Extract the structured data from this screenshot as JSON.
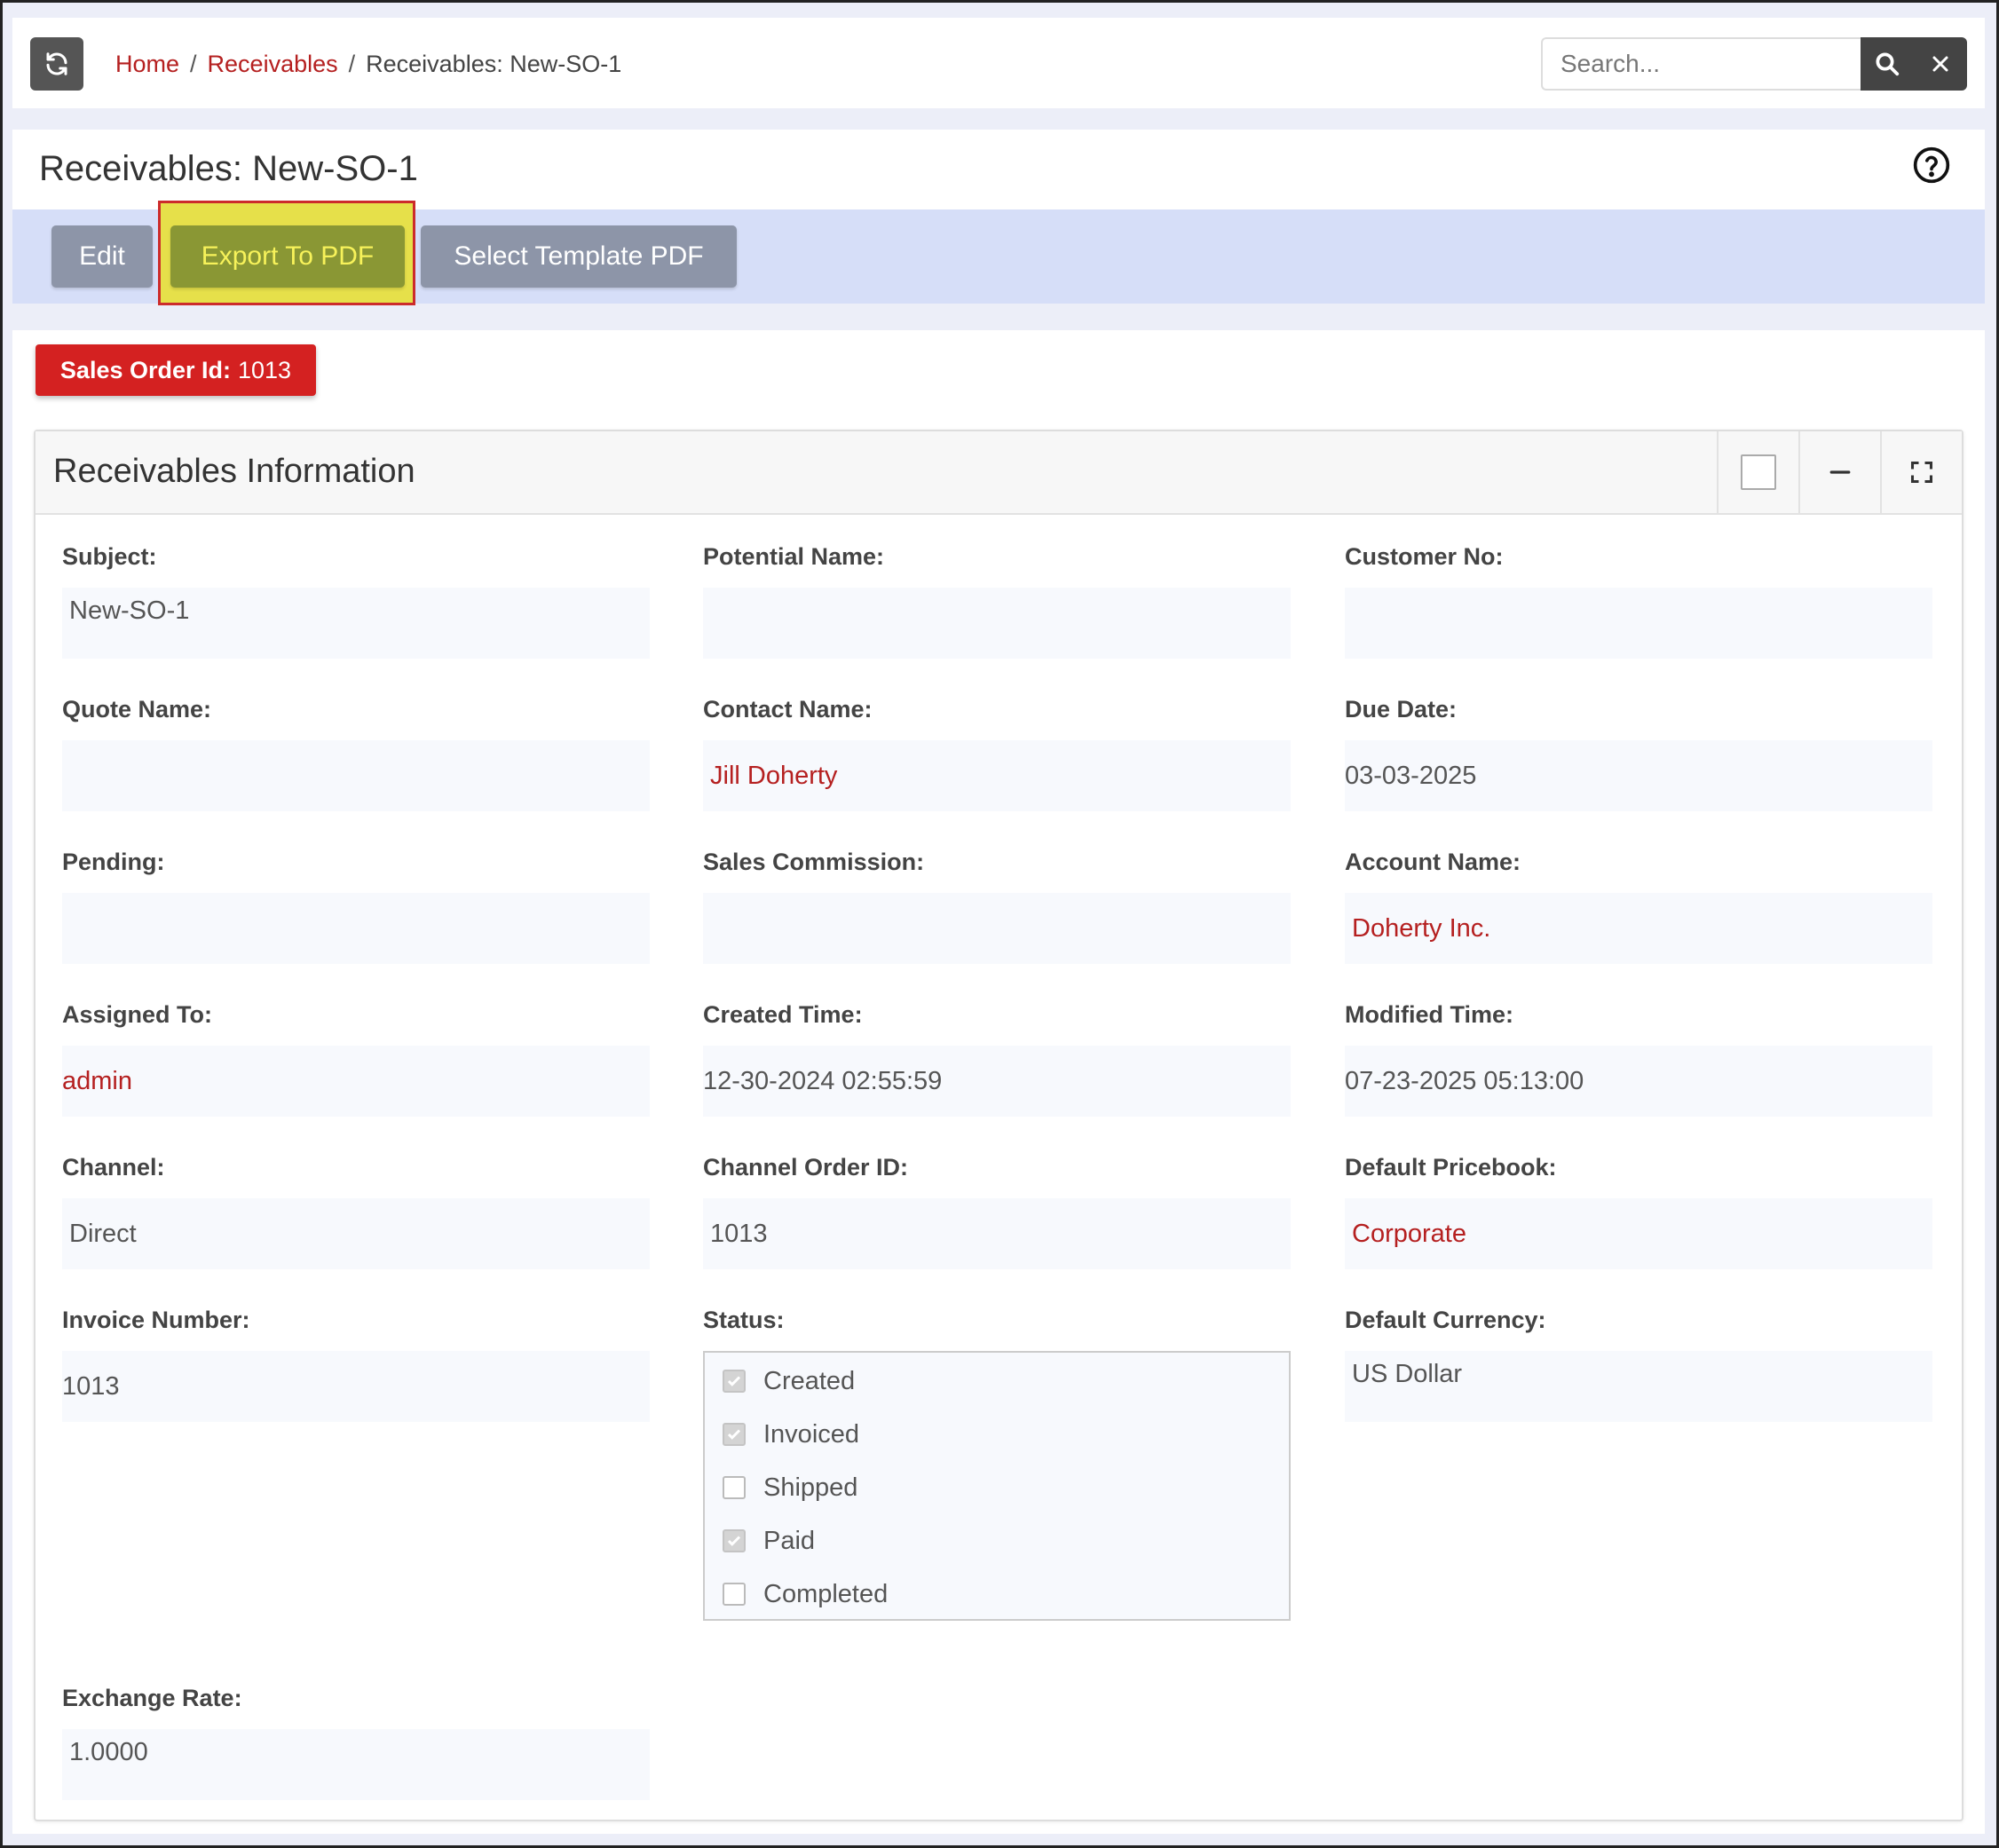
{
  "breadcrumb": {
    "home": "Home",
    "sep1": "/",
    "module": "Receivables",
    "sep2": "/",
    "current": "Receivables: New-SO-1"
  },
  "search": {
    "placeholder": "Search..."
  },
  "header": {
    "title": "Receivables: New-SO-1"
  },
  "actions": {
    "edit": "Edit",
    "export_pdf": "Export To PDF",
    "select_template": "Select Template PDF"
  },
  "badge": {
    "label": "Sales Order Id:",
    "value": "1013"
  },
  "panel": {
    "title": "Receivables Information",
    "fields": {
      "subject": {
        "label": "Subject:",
        "value": "New-SO-1"
      },
      "potential_name": {
        "label": "Potential Name:",
        "value": ""
      },
      "customer_no": {
        "label": "Customer No:",
        "value": ""
      },
      "quote_name": {
        "label": "Quote Name:",
        "value": ""
      },
      "contact_name": {
        "label": "Contact Name:",
        "value": "Jill Doherty"
      },
      "due_date": {
        "label": "Due Date:",
        "value": "03-03-2025"
      },
      "pending": {
        "label": "Pending:",
        "value": ""
      },
      "sales_commission": {
        "label": "Sales Commission:",
        "value": ""
      },
      "account_name": {
        "label": "Account Name:",
        "value": "Doherty Inc."
      },
      "assigned_to": {
        "label": "Assigned To:",
        "value": "admin"
      },
      "created_time": {
        "label": "Created Time:",
        "value": "12-30-2024 02:55:59"
      },
      "modified_time": {
        "label": "Modified Time:",
        "value": "07-23-2025 05:13:00"
      },
      "channel": {
        "label": "Channel:",
        "value": "Direct"
      },
      "channel_order_id": {
        "label": "Channel Order ID:",
        "value": "1013"
      },
      "default_pricebook": {
        "label": "Default Pricebook:",
        "value": "Corporate"
      },
      "invoice_number": {
        "label": "Invoice Number:",
        "value": "1013"
      },
      "status": {
        "label": "Status:",
        "options": [
          {
            "label": "Created",
            "checked": true
          },
          {
            "label": "Invoiced",
            "checked": true
          },
          {
            "label": "Shipped",
            "checked": false
          },
          {
            "label": "Paid",
            "checked": true
          },
          {
            "label": "Completed",
            "checked": false
          }
        ]
      },
      "default_currency": {
        "label": "Default Currency:",
        "value": "US Dollar"
      },
      "exchange_rate": {
        "label": "Exchange Rate:",
        "value": "1.0000"
      }
    }
  },
  "colors": {
    "link": "#b52020",
    "badge": "#d42121",
    "action_bar": "#d6def8",
    "highlight": "#e6e04a",
    "highlight_border": "#cc2b2b"
  },
  "icons": {
    "refresh": "refresh-icon",
    "search": "search-icon",
    "clear": "close-icon",
    "help": "question-circle-icon",
    "minimize": "minus-icon",
    "fullscreen": "expand-icon"
  }
}
